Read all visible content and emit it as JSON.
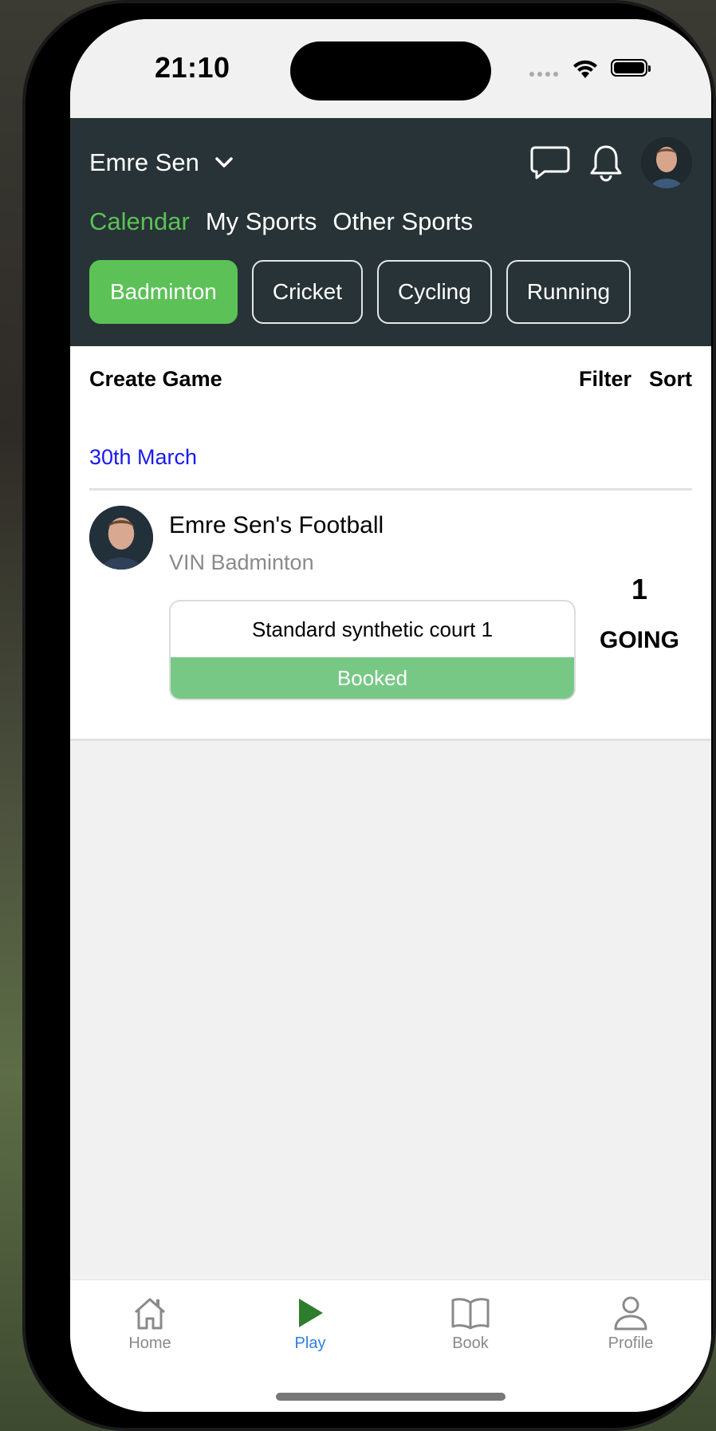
{
  "status_bar": {
    "time": "21:10"
  },
  "header": {
    "user_name": "Emre Sen",
    "tabs": [
      {
        "label": "Calendar",
        "active": true
      },
      {
        "label": "My Sports",
        "active": false
      },
      {
        "label": "Other Sports",
        "active": false
      }
    ],
    "sports": [
      {
        "label": "Badminton",
        "selected": true
      },
      {
        "label": "Cricket",
        "selected": false
      },
      {
        "label": "Cycling",
        "selected": false
      },
      {
        "label": "Running",
        "selected": false
      }
    ]
  },
  "toolbar": {
    "create_game": "Create Game",
    "filter": "Filter",
    "sort": "Sort"
  },
  "date_header": "30th March",
  "game": {
    "title": "Emre Sen's Football",
    "venue": "VIN Badminton",
    "court": "Standard synthetic court 1",
    "status": "Booked",
    "going_count": "1",
    "going_label": "GOING"
  },
  "bottom_nav": [
    {
      "label": "Home",
      "icon": "home-icon",
      "active": false
    },
    {
      "label": "Play",
      "icon": "play-icon",
      "active": true
    },
    {
      "label": "Book",
      "icon": "book-icon",
      "active": false
    },
    {
      "label": "Profile",
      "icon": "profile-icon",
      "active": false
    }
  ],
  "colors": {
    "header_bg": "#273336",
    "accent_green": "#5cc157",
    "booked_green": "#78c885",
    "date_blue": "#1a1aee",
    "active_tab_blue": "#2f7fe3"
  }
}
